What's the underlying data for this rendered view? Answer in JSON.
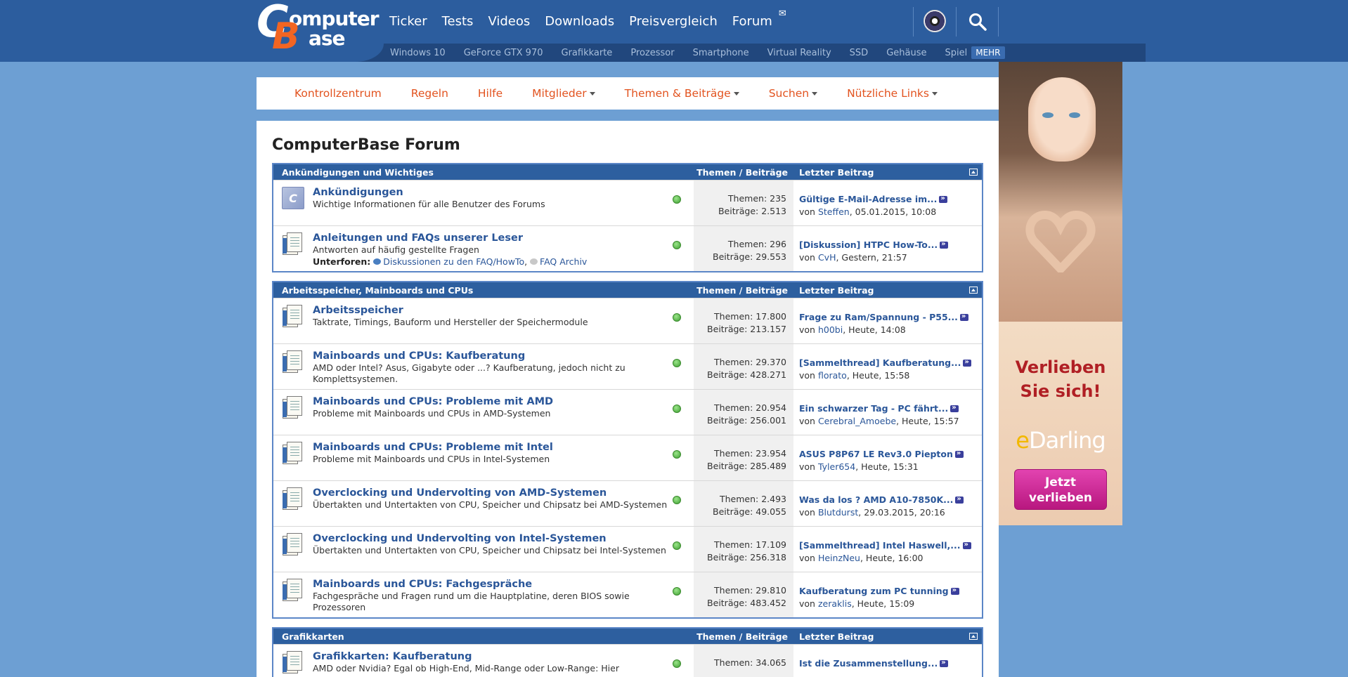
{
  "header": {
    "logo_line1": "omputer",
    "logo_line2": "ase",
    "logo_c": "C",
    "logo_b": "B",
    "nav": [
      "Ticker",
      "Tests",
      "Videos",
      "Downloads",
      "Preisvergleich",
      "Forum"
    ],
    "subnav": [
      "Windows 10",
      "GeForce GTX 970",
      "Grafikkarte",
      "Prozessor",
      "Smartphone",
      "Virtual Reality",
      "SSD",
      "Gehäuse",
      "Spiel"
    ],
    "more_label": "MEHR"
  },
  "forumnav": {
    "items": [
      "Kontrollzentrum",
      "Regeln",
      "Hilfe",
      "Mitglieder",
      "Themen & Beiträge",
      "Suchen",
      "Nützliche Links"
    ]
  },
  "page_title": "ComputerBase Forum",
  "col_stats": "Themen / Beiträge",
  "col_last": "Letzter Beitrag",
  "categories": [
    {
      "title": "Ankündigungen und Wichtiges",
      "forums": [
        {
          "title": "Ankündigungen",
          "desc": "Wichtige Informationen für alle Benutzer des Forums",
          "themen": "Themen: 235",
          "beitraege": "Beiträge: 2.513",
          "last_title": "Gültige E-Mail-Adresse im...",
          "by_prefix": "von",
          "last_user": "Steffen",
          "last_time": ", 05.01.2015, 10:08"
        },
        {
          "title": "Anleitungen und FAQs unserer Leser",
          "desc": "Antworten auf häufig gestellte Fragen",
          "subs_label": "Unterforen:",
          "sub1": "Diskussionen zu den FAQ/HowTo",
          "sub2": "FAQ Archiv",
          "themen": "Themen: 296",
          "beitraege": "Beiträge: 29.553",
          "last_title": "[Diskussion] HTPC How-To...",
          "by_prefix": "von",
          "last_user": "CvH",
          "last_time": ", Gestern, 21:57"
        }
      ]
    },
    {
      "title": "Arbeitsspeicher, Mainboards und CPUs",
      "forums": [
        {
          "title": "Arbeitsspeicher",
          "desc": "Taktrate, Timings, Bauform und Hersteller der Speichermodule",
          "themen": "Themen: 17.800",
          "beitraege": "Beiträge: 213.157",
          "last_title": "Frage zu Ram/Spannung - P55...",
          "by_prefix": "von",
          "last_user": "h00bi",
          "last_time": ", Heute, 14:08"
        },
        {
          "title": "Mainboards und CPUs: Kaufberatung",
          "desc": "AMD oder Intel? Asus, Gigabyte oder ...? Kaufberatung, jedoch nicht zu Komplettsystemen.",
          "themen": "Themen: 29.370",
          "beitraege": "Beiträge: 428.271",
          "last_title": "[Sammelthread] Kaufberatung...",
          "by_prefix": "von",
          "last_user": "florato",
          "last_time": ", Heute, 15:58"
        },
        {
          "title": "Mainboards und CPUs: Probleme mit AMD",
          "desc": "Probleme mit Mainboards und CPUs in AMD-Systemen",
          "themen": "Themen: 20.954",
          "beitraege": "Beiträge: 256.001",
          "last_title": "Ein schwarzer Tag - PC fährt...",
          "by_prefix": "von",
          "last_user": "Cerebral_Amoebe",
          "last_time": ", Heute, 15:57"
        },
        {
          "title": "Mainboards und CPUs: Probleme mit Intel",
          "desc": "Probleme mit Mainboards und CPUs in Intel-Systemen",
          "themen": "Themen: 23.954",
          "beitraege": "Beiträge: 285.489",
          "last_title": "ASUS P8P67 LE Rev3.0 Piepton",
          "by_prefix": "von",
          "last_user": "Tyler654",
          "last_time": ", Heute, 15:31"
        },
        {
          "title": "Overclocking und Undervolting von AMD-Systemen",
          "desc": "Übertakten und Untertakten von CPU, Speicher und Chipsatz bei AMD-Systemen",
          "themen": "Themen: 2.493",
          "beitraege": "Beiträge: 49.055",
          "last_title": "Was da los ? AMD A10-7850K...",
          "by_prefix": "von",
          "last_user": "Blutdurst",
          "last_time": ", 29.03.2015, 20:16"
        },
        {
          "title": "Overclocking und Undervolting von Intel-Systemen",
          "desc": "Übertakten und Untertakten von CPU, Speicher und Chipsatz bei Intel-Systemen",
          "themen": "Themen: 17.109",
          "beitraege": "Beiträge: 256.318",
          "last_title": "[Sammelthread] Intel Haswell,...",
          "by_prefix": "von",
          "last_user": "HeinzNeu",
          "last_time": ", Heute, 16:00"
        },
        {
          "title": "Mainboards und CPUs: Fachgespräche",
          "desc": "Fachgespräche und Fragen rund um die Hauptplatine, deren BIOS sowie Prozessoren",
          "themen": "Themen: 29.810",
          "beitraege": "Beiträge: 483.452",
          "last_title": "Kaufberatung zum PC tunning",
          "by_prefix": "von",
          "last_user": "zeraklis",
          "last_time": ", Heute, 15:09"
        }
      ]
    },
    {
      "title": "Grafikkarten",
      "forums": [
        {
          "title": "Grafikkarten: Kaufberatung",
          "desc": "AMD oder Nvidia? Egal ob High-End, Mid-Range oder Low-Range: Hier",
          "themen": "Themen: 34.065",
          "beitraege": "",
          "last_title": "Ist die Zusammenstellung...",
          "by_prefix": "",
          "last_user": "",
          "last_time": ""
        }
      ]
    }
  ],
  "ad": {
    "headline_1": "Verlieben",
    "headline_2": "Sie sich!",
    "brand_e": "e",
    "brand_rest": "Darling",
    "cta_1": "Jetzt",
    "cta_2": "verlieben"
  },
  "colors": {
    "header_bg": "#2c5d9e",
    "page_bg": "#6d9fd3",
    "accent_orange": "#e2531f",
    "link_blue": "#2a5699",
    "cat_head": "#2d5f9f"
  }
}
